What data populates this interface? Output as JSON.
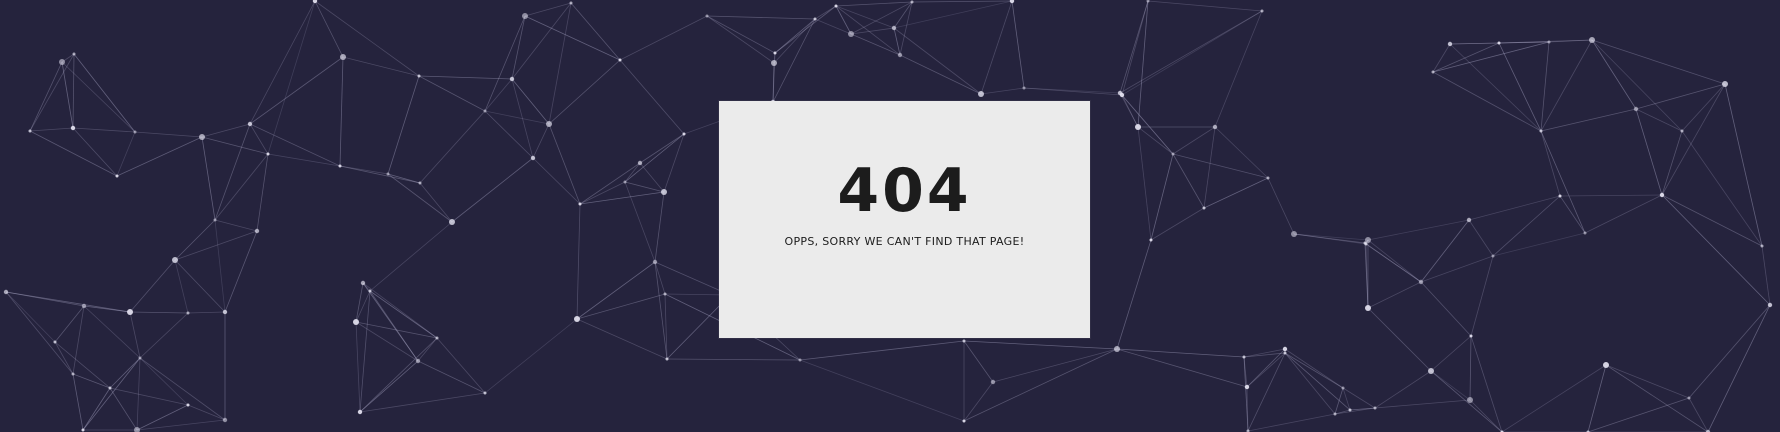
{
  "error_page": {
    "code": "404",
    "message": "OPPS, SORRY WE CAN'T FIND THAT PAGE!"
  },
  "colors": {
    "background": "#25233d",
    "card_background": "#ebebeb",
    "text": "#1c1c1c",
    "network_line": "#b9b6d6",
    "network_node": "#e6e4f2"
  },
  "decor": {
    "background_pattern": "particle-network"
  }
}
